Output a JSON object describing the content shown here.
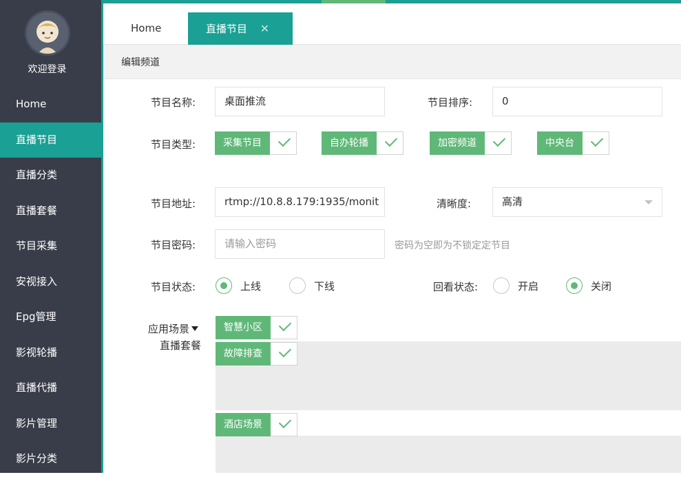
{
  "sidebar": {
    "welcome": "欢迎登录",
    "items": [
      {
        "label": "Home"
      },
      {
        "label": "直播节目",
        "active": true
      },
      {
        "label": "直播分类"
      },
      {
        "label": "直播套餐"
      },
      {
        "label": "节目采集"
      },
      {
        "label": "安视接入"
      },
      {
        "label": "Epg管理"
      },
      {
        "label": "影视轮播"
      },
      {
        "label": "直播代播"
      },
      {
        "label": "影片管理"
      },
      {
        "label": "影片分类"
      }
    ]
  },
  "tabs": {
    "home": "Home",
    "live": "直播节目",
    "close_glyph": "✕"
  },
  "breadcrumb": "编辑频道",
  "form": {
    "name_label": "节目名称:",
    "name_value": "桌面推流",
    "order_label": "节目排序:",
    "order_value": "0",
    "type_label": "节目类型:",
    "types": [
      "采集节目",
      "自办轮播",
      "加密频道",
      "中央台"
    ],
    "address_label": "节目地址:",
    "address_value": "rtmp://10.8.8.179:1935/monit",
    "clarity_label": "清晰度:",
    "clarity_value": "高清",
    "password_label": "节目密码:",
    "password_placeholder": "请输入密码",
    "password_hint": "密码为空即为不锁定定节目",
    "status_label": "节目状态:",
    "status_on": "上线",
    "status_off": "下线",
    "replay_label": "回看状态:",
    "replay_open": "开启",
    "replay_close": "关闭",
    "scene_label": "应用场景",
    "package_label": "直播套餐",
    "scenes": [
      "智慧小区",
      "故障排查",
      "酒店场景"
    ]
  },
  "colors": {
    "sidebar_bg": "#393d49",
    "accent": "#1aa094",
    "green": "#5fb878"
  }
}
